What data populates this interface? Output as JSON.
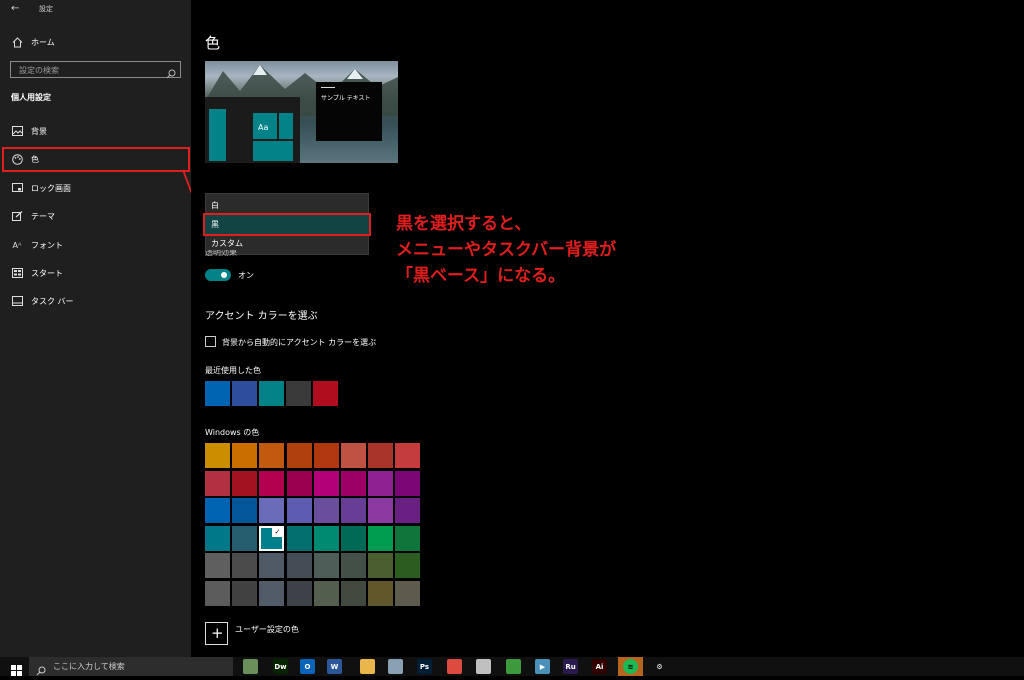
{
  "window": {
    "title": "設定",
    "back_icon": "back-arrow-icon"
  },
  "sidebar": {
    "home_label": "ホーム",
    "search_placeholder": "設定の検索",
    "section_title": "個人用設定",
    "items": [
      {
        "label": "背景",
        "icon": "picture-icon"
      },
      {
        "label": "色",
        "icon": "palette-icon"
      },
      {
        "label": "ロック画面",
        "icon": "lock-screen-icon"
      },
      {
        "label": "テーマ",
        "icon": "theme-icon"
      },
      {
        "label": "フォント",
        "icon": "font-icon"
      },
      {
        "label": "スタート",
        "icon": "start-icon"
      },
      {
        "label": "タスク バー",
        "icon": "taskbar-icon"
      }
    ]
  },
  "main": {
    "title": "色",
    "preview_sample_text": "サンプル テキスト",
    "preview_tile_text": "Aa",
    "dropdown": {
      "options": [
        "白",
        "黒",
        "カスタム"
      ],
      "selected": "黒"
    },
    "transparency_label_partial": "透明効果",
    "toggle": {
      "state_label": "オン",
      "on": true
    },
    "accent_heading": "アクセント カラーを選ぶ",
    "auto_accent_label": "背景から自動的にアクセント カラーを選ぶ",
    "recent_label": "最近使用した色",
    "recent_colors": [
      "#0063b1",
      "#2d4d9d",
      "#038387",
      "#3a3a3a",
      "#b00e1e"
    ],
    "windows_colors_label": "Windows の色",
    "windows_colors": [
      [
        "#ca8e00",
        "#ca6e00",
        "#bf5a0e",
        "#b0410e",
        "#b0370e",
        "#c05243",
        "#a9342a",
        "#c43c3c"
      ],
      [
        "#b2303f",
        "#a3121f",
        "#b3004f",
        "#9b0050",
        "#b30078",
        "#9c0066",
        "#8e218f",
        "#7b0777"
      ],
      [
        "#0063b1",
        "#02569a",
        "#6b6cb9",
        "#5d5cb1",
        "#6a4e9e",
        "#673d96",
        "#8a3aa0",
        "#6a1f83"
      ],
      [
        "#00788a",
        "#255c6e",
        "#00808a",
        "#026f6e",
        "#008a72",
        "#016a56",
        "#009c4f",
        "#10753b"
      ],
      [
        "#5f5f5f",
        "#4b4b4b",
        "#4f5a66",
        "#444d55",
        "#4d5e58",
        "#435047",
        "#4a5e2f",
        "#2d5c21"
      ],
      [
        "#5c5c5c",
        "#414141",
        "#525c68",
        "#3c4248",
        "#535e4e",
        "#424a40",
        "#62572b",
        "#5d5a4e"
      ]
    ],
    "selected_swatch": {
      "row": 3,
      "col": 2
    },
    "custom_color_label": "ユーザー設定の色"
  },
  "annotation": {
    "lines": [
      "黒を選択すると、",
      "メニューやタスクバー背景が",
      "「黒ベース」になる。"
    ],
    "color": "#e01e1e"
  },
  "taskbar": {
    "search_placeholder": "ここに入力して検索",
    "apps": [
      {
        "name": "app-icon-1",
        "label": "",
        "color": "#6b8f5a"
      },
      {
        "name": "dreamweaver-icon",
        "label": "Dw",
        "color": "#072401"
      },
      {
        "name": "outlook-icon",
        "label": "O",
        "color": "#0a64ba"
      },
      {
        "name": "word-icon",
        "label": "W",
        "color": "#2b579a"
      },
      {
        "name": "file-explorer-icon",
        "label": "",
        "color": "#e8b64a"
      },
      {
        "name": "app-icon-6",
        "label": "",
        "color": "#8aa0b3"
      },
      {
        "name": "photoshop-icon",
        "label": "Ps",
        "color": "#001e36"
      },
      {
        "name": "chrome-icon",
        "label": "",
        "color": "#dd4b3e"
      },
      {
        "name": "app-icon-9",
        "label": "",
        "color": "#c0c0c0"
      },
      {
        "name": "app-icon-10",
        "label": "",
        "color": "#3c9a3c"
      },
      {
        "name": "media-player-icon",
        "label": "▶",
        "color": "#4a90b8"
      },
      {
        "name": "premiere-rush-icon",
        "label": "Ru",
        "color": "#2a1a4d"
      },
      {
        "name": "illustrator-icon",
        "label": "Ai",
        "color": "#330000"
      },
      {
        "name": "spotify-icon",
        "label": "≋",
        "color": "#1db954"
      },
      {
        "name": "settings-gear-icon",
        "label": "⚙",
        "color": "#101010"
      }
    ]
  }
}
